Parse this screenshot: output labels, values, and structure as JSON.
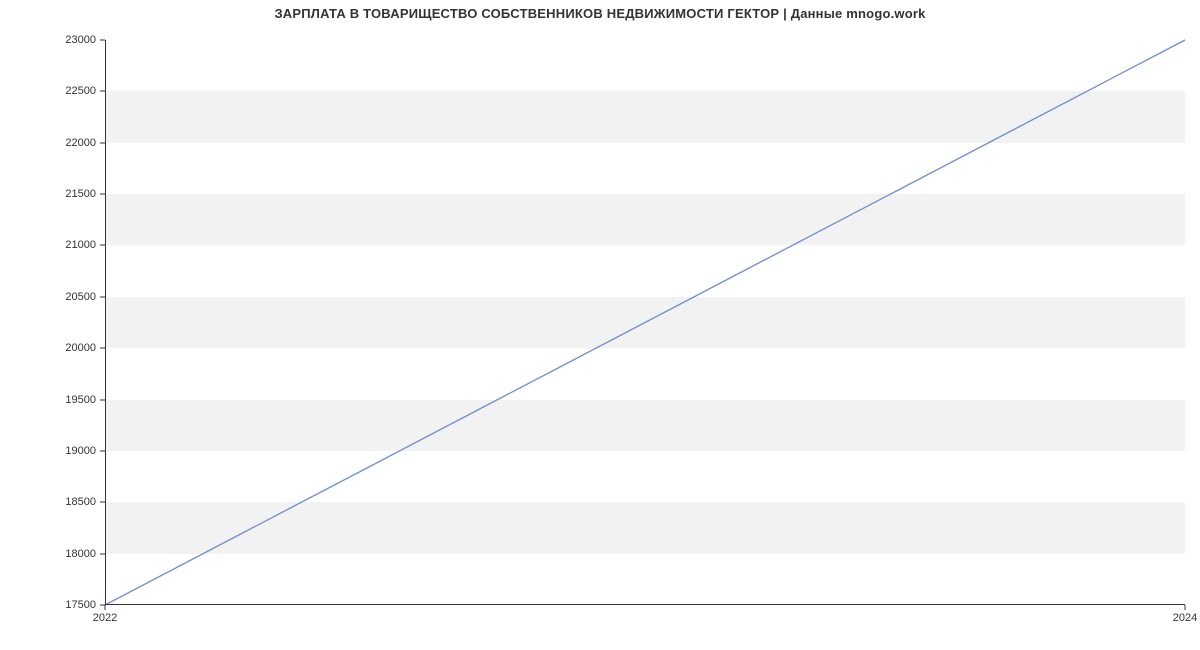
{
  "chart_data": {
    "type": "line",
    "title": "ЗАРПЛАТА В ТОВАРИЩЕСТВО СОБСТВЕННИКОВ НЕДВИЖИМОСТИ ГЕКТОР | Данные mnogo.work",
    "x": [
      2022,
      2024
    ],
    "values": [
      17500,
      23000
    ],
    "x_tick_labels": [
      "2022",
      "2024"
    ],
    "y_tick_labels": [
      "17500",
      "18000",
      "18500",
      "19000",
      "19500",
      "20000",
      "20500",
      "21000",
      "21500",
      "22000",
      "22500",
      "23000"
    ],
    "y_tick_values": [
      17500,
      18000,
      18500,
      19000,
      19500,
      20000,
      20500,
      21000,
      21500,
      22000,
      22500,
      23000
    ],
    "xlabel": "",
    "ylabel": "",
    "xlim": [
      2022,
      2024
    ],
    "ylim": [
      17500,
      23000
    ],
    "line_color": "#6b8ecf",
    "band_color": "#f2f2f2"
  }
}
